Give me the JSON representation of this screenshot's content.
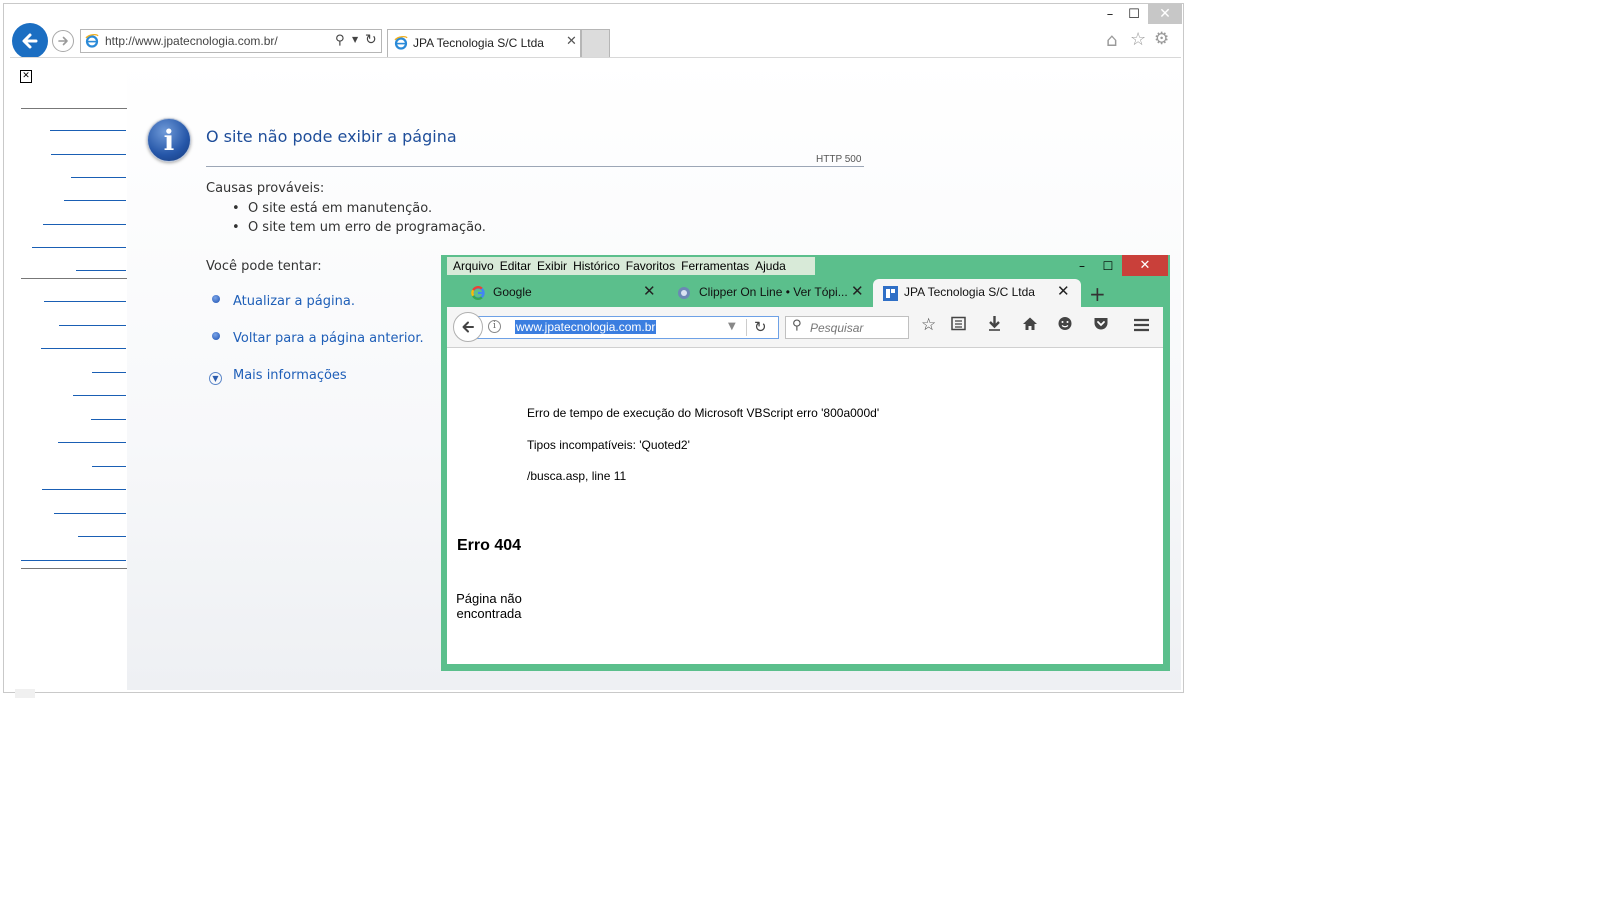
{
  "ie": {
    "window_controls": {
      "minimize": "–",
      "maximize": "☐",
      "close": "✕"
    },
    "address": "http://www.jpatecnologia.com.br/",
    "tab_title": "JPA Tecnologia S/C Ltda",
    "tab_close": "✕",
    "icons": [
      "back-arrow-icon",
      "forward-arrow-icon",
      "ie-logo-icon",
      "search-icon",
      "dropdown-icon",
      "refresh-icon",
      "home-icon",
      "favorites-icon",
      "gear-icon"
    ],
    "error": {
      "title": "O site não pode exibir a página",
      "code": "HTTP 500",
      "causes_heading": "Causas prováveis:",
      "causes": [
        "O site está em manutenção.",
        "O site tem um erro de programação."
      ],
      "try_heading": "Você pode tentar:",
      "actions": [
        "Atualizar a página.",
        "Voltar para a página anterior."
      ],
      "more_info": "Mais informações"
    },
    "colors": {
      "accent": "#1b6ec2",
      "title": "#1f4e9a",
      "link": "#1f5fb8"
    }
  },
  "ff": {
    "menu": [
      "Arquivo",
      "Editar",
      "Exibir",
      "Histórico",
      "Favoritos",
      "Ferramentas",
      "Ajuda"
    ],
    "window_controls": {
      "minimize": "–",
      "maximize": "☐",
      "close": "✕"
    },
    "tabs": [
      {
        "title": "Google",
        "close": "✕"
      },
      {
        "title": "Clipper On Line • Ver Tópi...",
        "close": "✕"
      },
      {
        "title": "JPA Tecnologia S/C Ltda",
        "close": "✕"
      }
    ],
    "new_tab": "+",
    "url": "www.jpatecnologia.com.br",
    "search_placeholder": "Pesquisar",
    "icons": [
      "back-icon",
      "info-icon",
      "url-dropdown-icon",
      "reload-icon",
      "search-icon",
      "bookmark-star-icon",
      "reading-list-icon",
      "download-icon",
      "home-icon",
      "chat-icon",
      "pocket-icon",
      "hamburger-menu-icon"
    ],
    "page": {
      "line1": "Erro de tempo de execução do Microsoft VBScript erro '800a000d'",
      "line2": "Tipos incompatíveis: 'Quoted2'",
      "line3": "/busca.asp, line 11",
      "err_title": "Erro 404",
      "err_desc": "Página não encontrada"
    },
    "colors": {
      "frame": "#5bbf8c",
      "close": "#c9403a",
      "url_highlight": "#3b7ee0"
    }
  }
}
